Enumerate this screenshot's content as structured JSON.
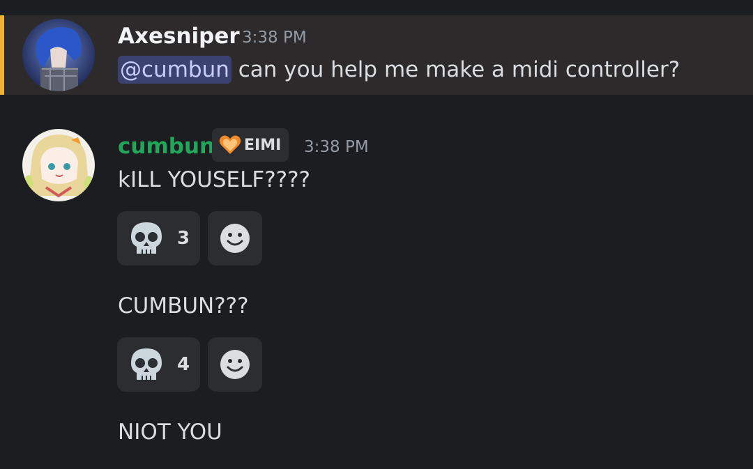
{
  "messages": [
    {
      "author": "Axesniper",
      "author_color": "#f2f3f5",
      "timestamp": "3:38 PM",
      "mention": "@cumbun",
      "text": " can you help me make a midi controller?",
      "highlighted": true,
      "highlight_color": "#f0b232"
    },
    {
      "author": "cumbun",
      "author_color": "#23a55a",
      "role_badge": "EIMI",
      "timestamp": "3:38 PM",
      "lines": [
        {
          "text": "kILL YOUSELF????",
          "reaction": {
            "emoji": "skull-emoji",
            "count": "3"
          }
        },
        {
          "text": "CUMBUN???",
          "reaction": {
            "emoji": "skull-emoji",
            "count": "4"
          }
        },
        {
          "text": "NIOT YOU"
        }
      ]
    }
  ]
}
